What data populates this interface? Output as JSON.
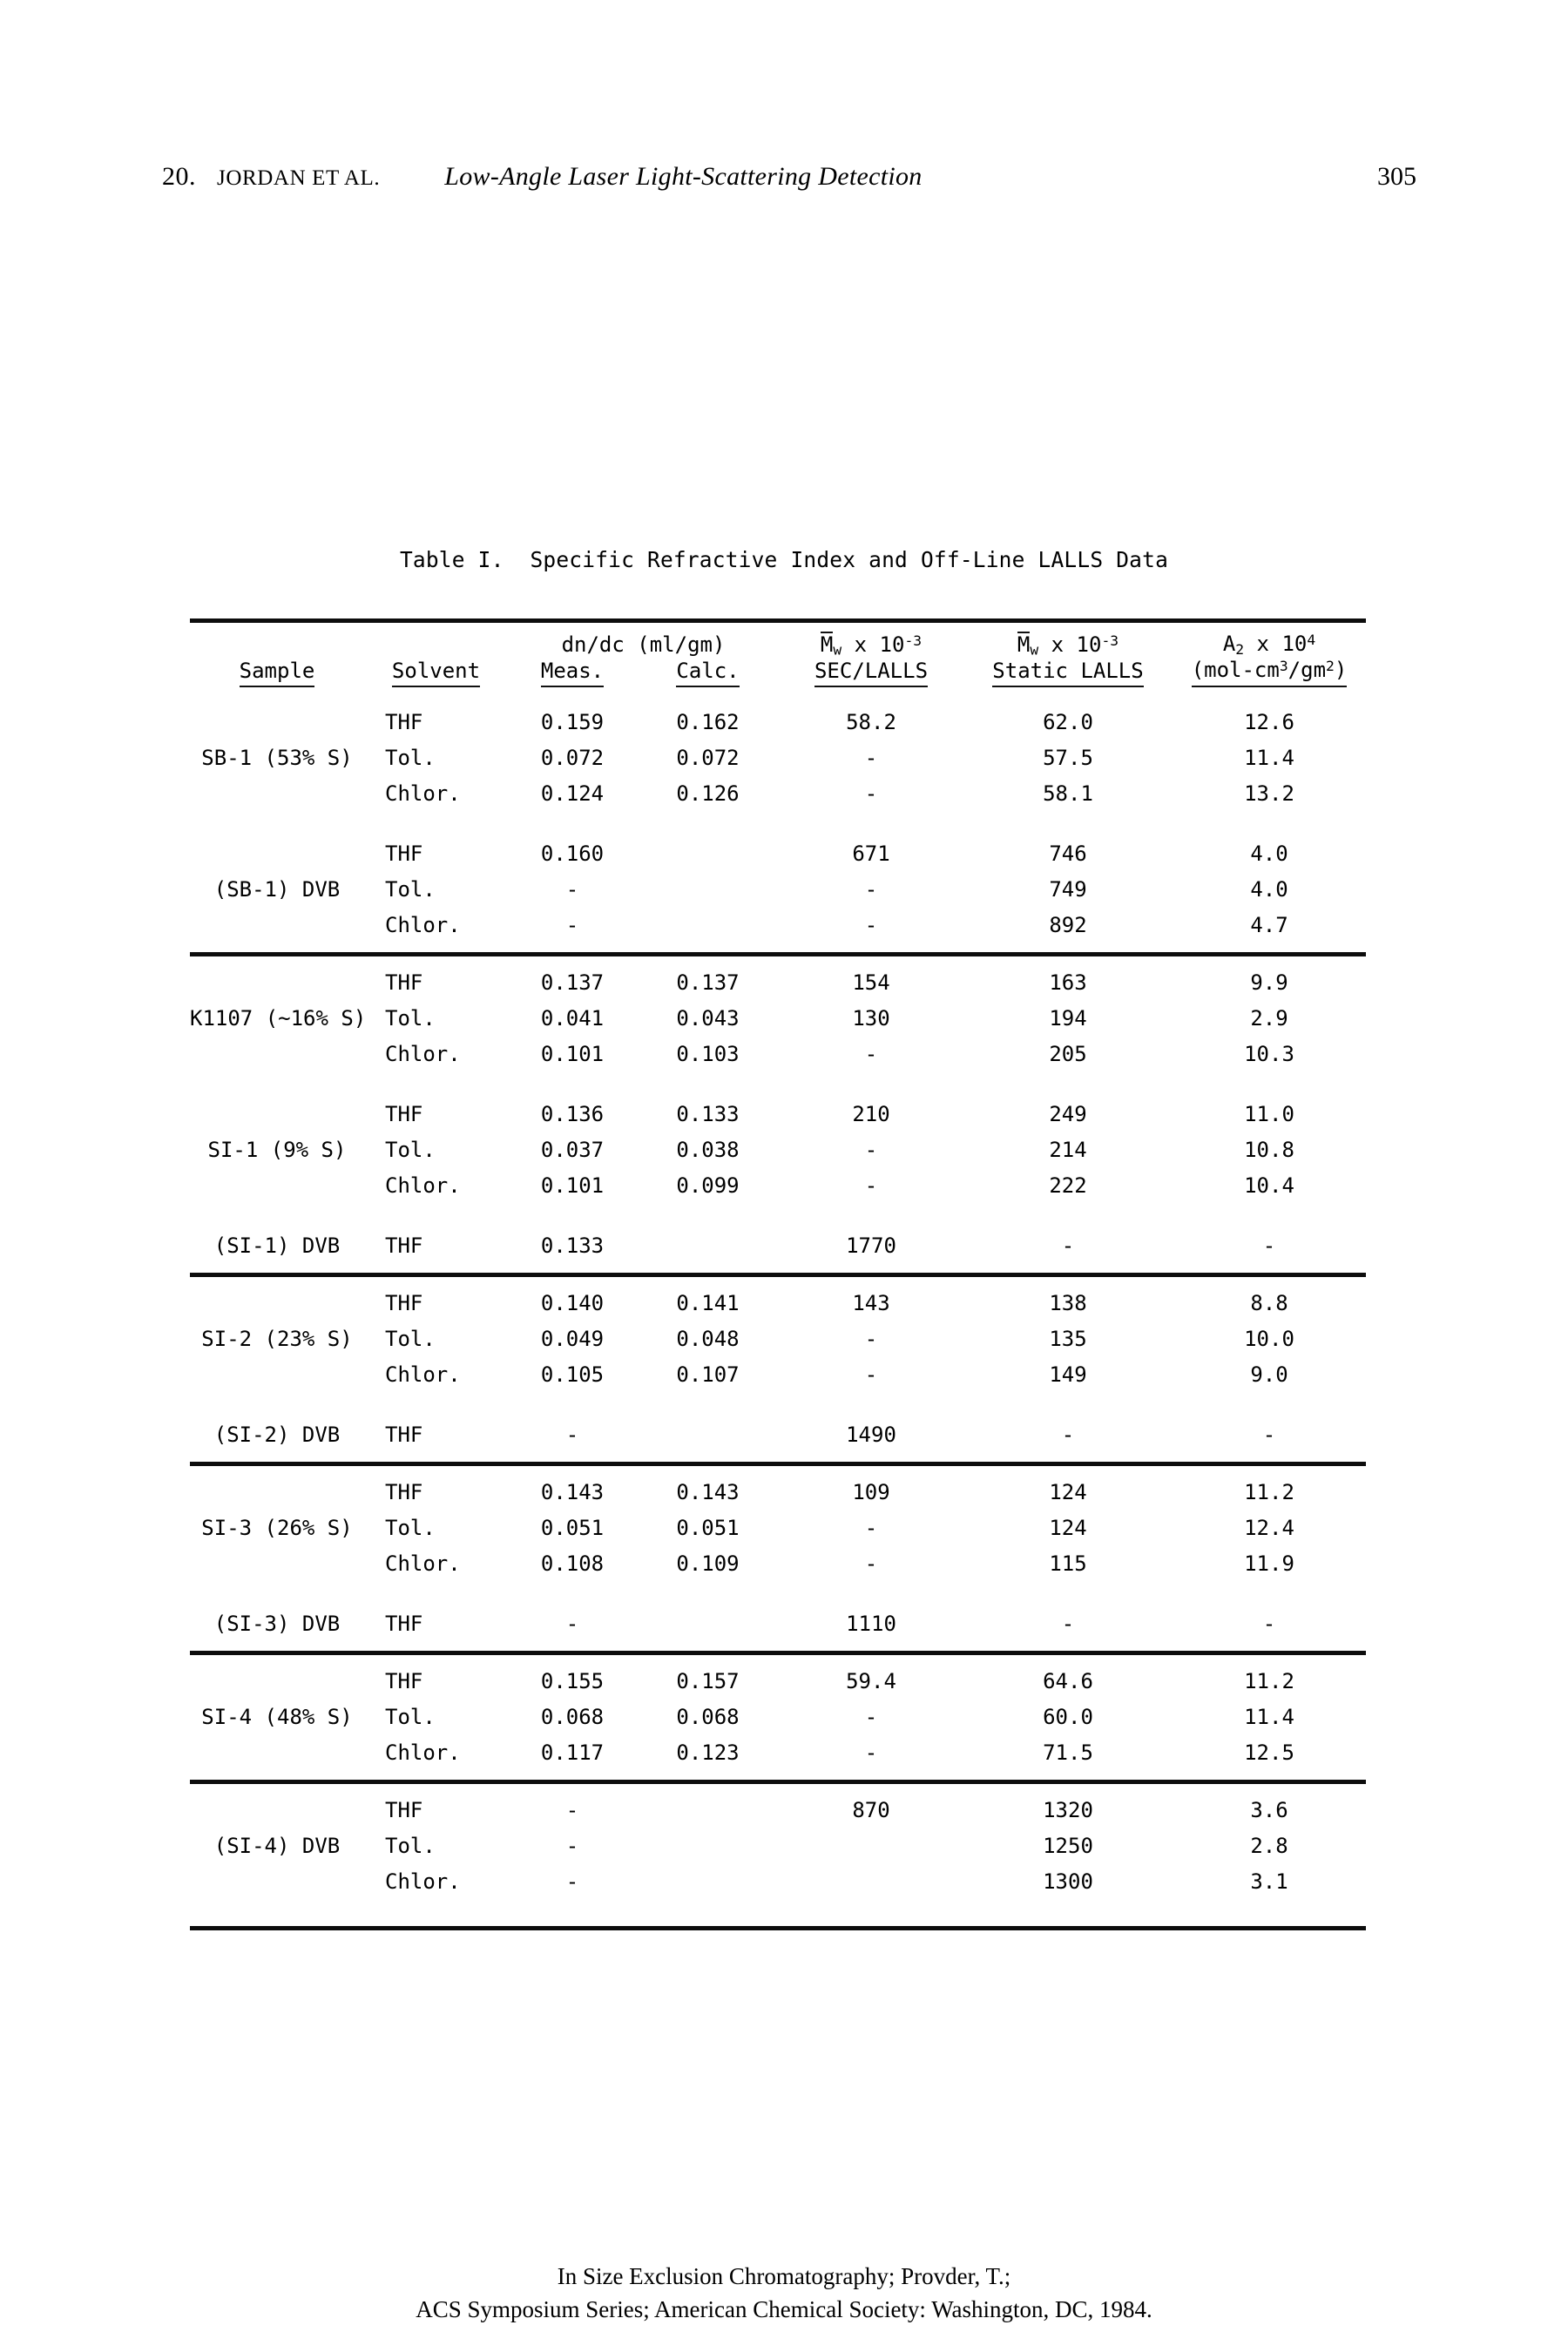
{
  "running_head": {
    "chapter_number": "20.",
    "authors": "JORDAN ET AL.",
    "title": "Low-Angle Laser Light-Scattering Detection",
    "page_number": "305"
  },
  "table": {
    "caption": "Table I.  Specific Refractive Index and Off-Line LALLS Data",
    "group_header_dndc": "dn/dc (ml/gm)",
    "group_header_mw_sec": "M̄w x 10⁻³",
    "group_header_mw_static": "M̄w x 10⁻³",
    "group_header_a2": "A₂ x 10⁴",
    "columns": {
      "sample": "Sample",
      "solvent": "Solvent",
      "meas": "Meas.",
      "calc": "Calc.",
      "sec_lalls": "SEC/LALLS",
      "static_lalls": "Static LALLS",
      "a2_units": "(mol-cm³/gm²)"
    },
    "blocks": [
      {
        "sample": "SB-1\n(53% S)",
        "rows": [
          {
            "solvent": "THF",
            "meas": "0.159",
            "calc": "0.162",
            "sec": "58.2",
            "static": "62.0",
            "a2": "12.6"
          },
          {
            "solvent": "Tol.",
            "meas": "0.072",
            "calc": "0.072",
            "sec": "-",
            "static": "57.5",
            "a2": "11.4"
          },
          {
            "solvent": "Chlor.",
            "meas": "0.124",
            "calc": "0.126",
            "sec": "-",
            "static": "58.1",
            "a2": "13.2"
          }
        ]
      },
      {
        "sample": "(SB-1) DVB",
        "rows": [
          {
            "solvent": "THF",
            "meas": "0.160",
            "calc": "",
            "sec": "671",
            "static": "746",
            "a2": "4.0"
          },
          {
            "solvent": "Tol.",
            "meas": "-",
            "calc": "",
            "sec": "-",
            "static": "749",
            "a2": "4.0"
          },
          {
            "solvent": "Chlor.",
            "meas": "-",
            "calc": "",
            "sec": "-",
            "static": "892",
            "a2": "4.7"
          }
        ]
      },
      {
        "sample": "K1107\n(~16% S)",
        "rows": [
          {
            "solvent": "THF",
            "meas": "0.137",
            "calc": "0.137",
            "sec": "154",
            "static": "163",
            "a2": "9.9"
          },
          {
            "solvent": "Tol.",
            "meas": "0.041",
            "calc": "0.043",
            "sec": "130",
            "static": "194",
            "a2": "2.9"
          },
          {
            "solvent": "Chlor.",
            "meas": "0.101",
            "calc": "0.103",
            "sec": "-",
            "static": "205",
            "a2": "10.3"
          }
        ]
      },
      {
        "sample": "SI-1\n(9% S)",
        "rows": [
          {
            "solvent": "THF",
            "meas": "0.136",
            "calc": "0.133",
            "sec": "210",
            "static": "249",
            "a2": "11.0"
          },
          {
            "solvent": "Tol.",
            "meas": "0.037",
            "calc": "0.038",
            "sec": "-",
            "static": "214",
            "a2": "10.8"
          },
          {
            "solvent": "Chlor.",
            "meas": "0.101",
            "calc": "0.099",
            "sec": "-",
            "static": "222",
            "a2": "10.4"
          }
        ]
      },
      {
        "sample": "(SI-1) DVB",
        "rows": [
          {
            "solvent": "THF",
            "meas": "0.133",
            "calc": "",
            "sec": "1770",
            "static": "-",
            "a2": "-"
          }
        ]
      },
      {
        "sample": "SI-2\n(23% S)",
        "rows": [
          {
            "solvent": "THF",
            "meas": "0.140",
            "calc": "0.141",
            "sec": "143",
            "static": "138",
            "a2": "8.8"
          },
          {
            "solvent": "Tol.",
            "meas": "0.049",
            "calc": "0.048",
            "sec": "-",
            "static": "135",
            "a2": "10.0"
          },
          {
            "solvent": "Chlor.",
            "meas": "0.105",
            "calc": "0.107",
            "sec": "-",
            "static": "149",
            "a2": "9.0"
          }
        ]
      },
      {
        "sample": "(SI-2) DVB",
        "rows": [
          {
            "solvent": "THF",
            "meas": "-",
            "calc": "",
            "sec": "1490",
            "static": "-",
            "a2": "-"
          }
        ]
      },
      {
        "sample": "SI-3\n(26% S)",
        "rows": [
          {
            "solvent": "THF",
            "meas": "0.143",
            "calc": "0.143",
            "sec": "109",
            "static": "124",
            "a2": "11.2"
          },
          {
            "solvent": "Tol.",
            "meas": "0.051",
            "calc": "0.051",
            "sec": "-",
            "static": "124",
            "a2": "12.4"
          },
          {
            "solvent": "Chlor.",
            "meas": "0.108",
            "calc": "0.109",
            "sec": "-",
            "static": "115",
            "a2": "11.9"
          }
        ]
      },
      {
        "sample": "(SI-3) DVB",
        "rows": [
          {
            "solvent": "THF",
            "meas": "-",
            "calc": "",
            "sec": "1110",
            "static": "-",
            "a2": "-"
          }
        ]
      },
      {
        "sample": "SI-4\n(48% S)",
        "rows": [
          {
            "solvent": "THF",
            "meas": "0.155",
            "calc": "0.157",
            "sec": "59.4",
            "static": "64.6",
            "a2": "11.2"
          },
          {
            "solvent": "Tol.",
            "meas": "0.068",
            "calc": "0.068",
            "sec": "-",
            "static": "60.0",
            "a2": "11.4"
          },
          {
            "solvent": "Chlor.",
            "meas": "0.117",
            "calc": "0.123",
            "sec": "-",
            "static": "71.5",
            "a2": "12.5"
          }
        ]
      },
      {
        "sample": "(SI-4) DVB",
        "rows": [
          {
            "solvent": "THF",
            "meas": "-",
            "calc": "",
            "sec": "870",
            "static": "1320",
            "a2": "3.6"
          },
          {
            "solvent": "Tol.",
            "meas": "-",
            "calc": "",
            "sec": "",
            "static": "1250",
            "a2": "2.8"
          },
          {
            "solvent": "Chlor.",
            "meas": "-",
            "calc": "",
            "sec": "",
            "static": "1300",
            "a2": "3.1"
          }
        ]
      }
    ]
  },
  "footer": {
    "line1": "In Size Exclusion Chromatography; Provder, T.;",
    "line2": "ACS Symposium Series; American Chemical Society: Washington, DC, 1984."
  }
}
